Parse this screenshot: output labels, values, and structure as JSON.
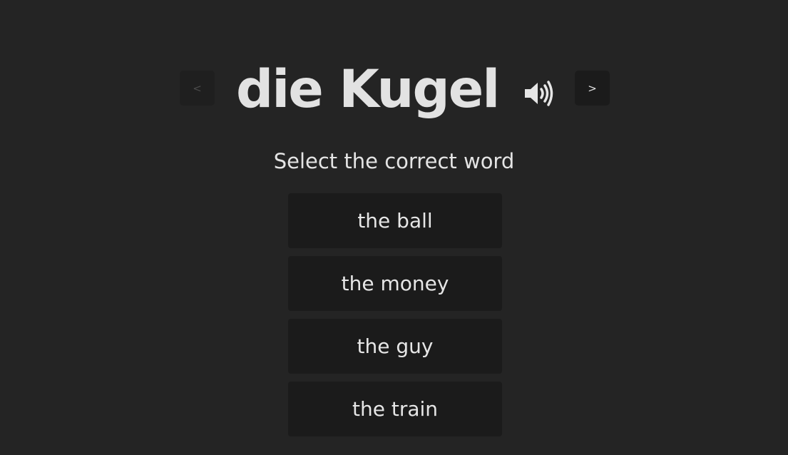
{
  "card": {
    "word": "die Kugel",
    "prev_label": "<",
    "next_label": ">",
    "prompt": "Select the correct word",
    "speaker_icon": "speaker-volume-icon"
  },
  "options": [
    {
      "label": "the ball"
    },
    {
      "label": "the money"
    },
    {
      "label": "the guy"
    },
    {
      "label": "the train"
    }
  ],
  "colors": {
    "background": "#242424",
    "button": "#1b1b1b",
    "text": "#e6e6e6"
  }
}
